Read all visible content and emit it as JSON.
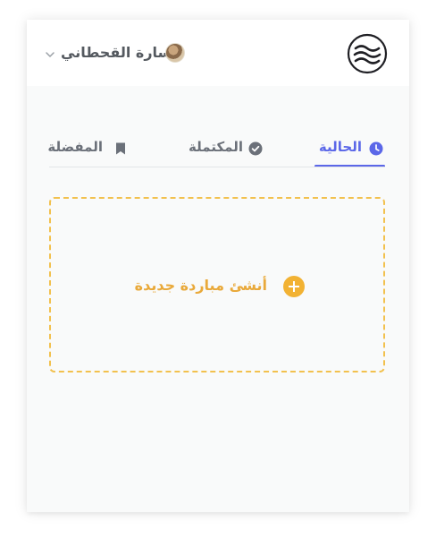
{
  "header": {
    "user_name": "سارة القحطاني",
    "logo_icon": "waves-logo-icon",
    "dropdown_icon": "chevron-down-icon"
  },
  "tabs": [
    {
      "label": "الحالية",
      "icon": "clock-icon",
      "active": true
    },
    {
      "label": "المكتملة",
      "icon": "check-circle-icon",
      "active": false
    },
    {
      "label": "المفضلة",
      "icon": "bookmark-icon",
      "active": false
    }
  ],
  "create_match": {
    "label": "أنشئ مباردة جديدة",
    "icon": "plus-circle-icon"
  },
  "colors": {
    "accent": "#5b67e8",
    "create_accent": "#f2b233",
    "text_muted": "#6b7079"
  }
}
